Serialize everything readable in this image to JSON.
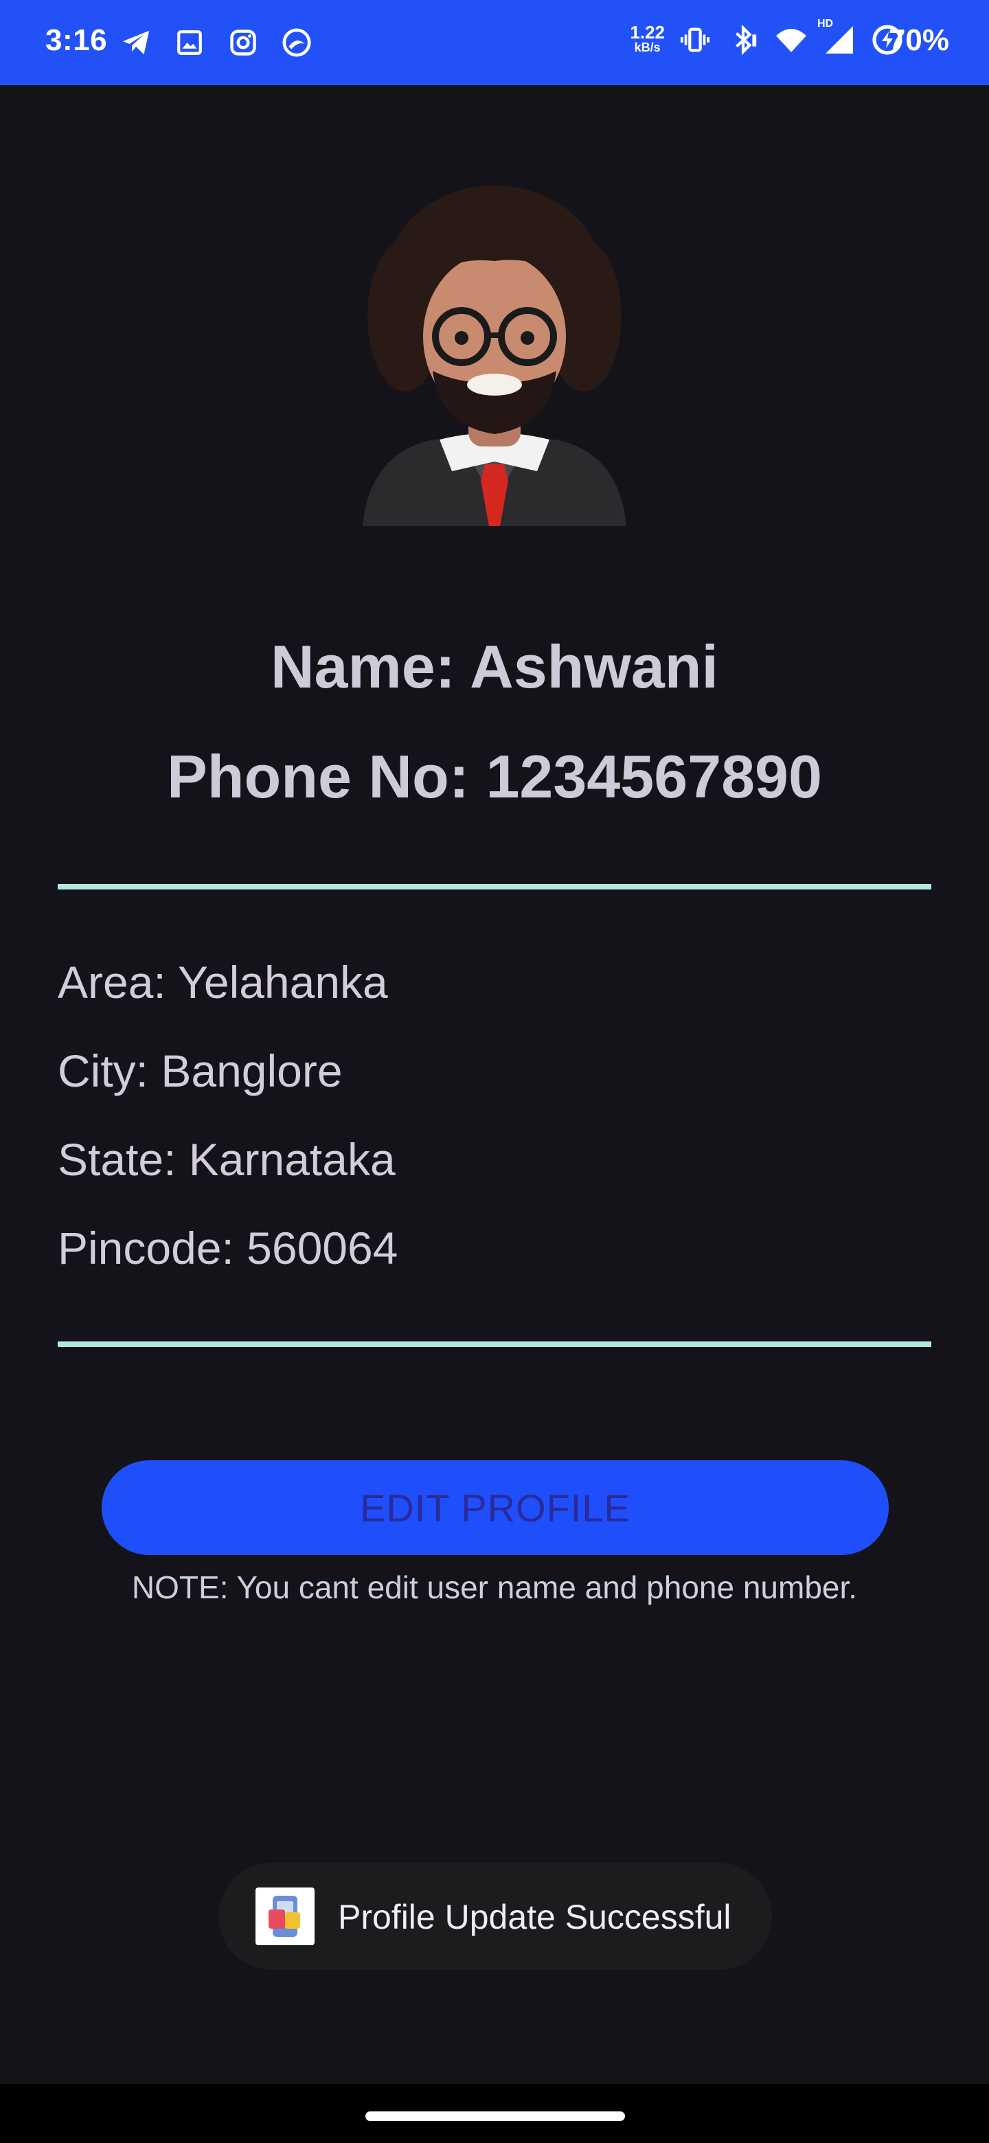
{
  "status_bar": {
    "time": "3:16",
    "network_speed_value": "1.22",
    "network_speed_unit": "kB/s",
    "network_badge": "HD",
    "battery": "70%",
    "left_icons": [
      "telegram-icon",
      "gallery-icon",
      "instagram-icon",
      "app-icon"
    ],
    "right_icons": [
      "vibrate-icon",
      "bluetooth-icon",
      "wifi-icon",
      "signal-icon",
      "battery-saver-icon"
    ],
    "color": "#2252f7"
  },
  "profile": {
    "avatar": "avatar-3d-man-glasses",
    "name": "Name: Ashwani",
    "phone": "Phone No: 1234567890",
    "area": "Area: Yelahanka",
    "city": "City: Banglore",
    "state": "State: Karnataka",
    "pincode": "Pincode: 560064"
  },
  "actions": {
    "edit_label": "EDIT PROFILE",
    "note": "NOTE: You cant edit user name and phone number."
  },
  "toast": {
    "message": "Profile Update Successful",
    "icon": "app-shopping-icon"
  },
  "colors": {
    "background": "#14131a",
    "accent": "#1f4ffb",
    "divider": "#b4e6e3"
  }
}
